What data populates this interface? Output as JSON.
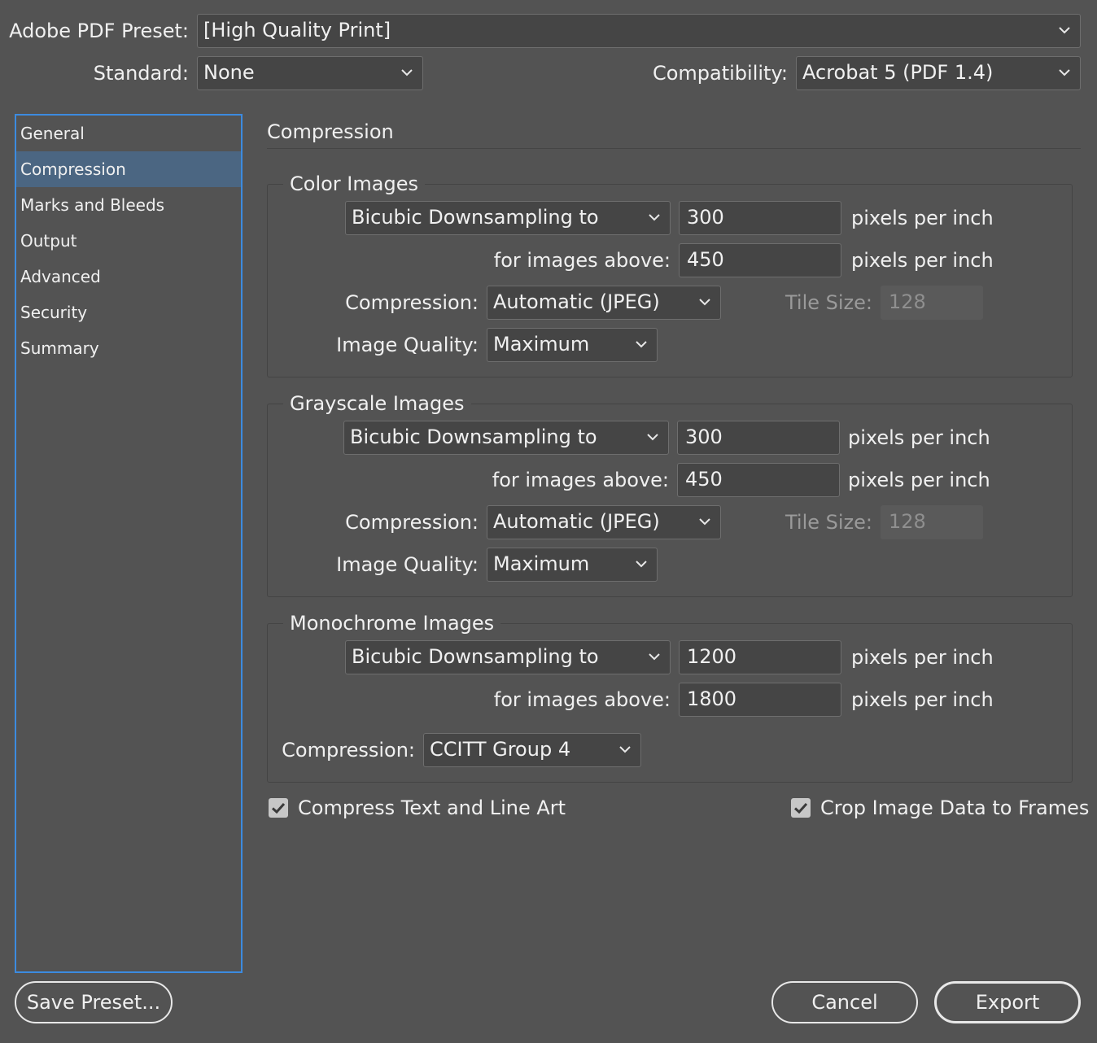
{
  "header": {
    "preset_label": "Adobe PDF Preset:",
    "preset_value": "[High Quality Print]",
    "standard_label": "Standard:",
    "standard_value": "None",
    "compat_label": "Compatibility:",
    "compat_value": "Acrobat 5 (PDF 1.4)"
  },
  "sidebar": {
    "items": [
      {
        "label": "General"
      },
      {
        "label": "Compression"
      },
      {
        "label": "Marks and Bleeds"
      },
      {
        "label": "Output"
      },
      {
        "label": "Advanced"
      },
      {
        "label": "Security"
      },
      {
        "label": "Summary"
      }
    ],
    "selected": "Compression"
  },
  "main": {
    "title": "Compression",
    "color": {
      "title": "Color Images",
      "sampling": "Bicubic Downsampling to",
      "ppi": "300",
      "ppi_unit": "pixels per inch",
      "above_label": "for images above:",
      "above": "450",
      "above_unit": "pixels per inch",
      "compression_label": "Compression:",
      "compression": "Automatic (JPEG)",
      "tile_label": "Tile Size:",
      "tile": "128",
      "quality_label": "Image Quality:",
      "quality": "Maximum"
    },
    "gray": {
      "title": "Grayscale Images",
      "sampling": "Bicubic Downsampling to",
      "ppi": "300",
      "ppi_unit": "pixels per inch",
      "above_label": "for images above:",
      "above": "450",
      "above_unit": "pixels per inch",
      "compression_label": "Compression:",
      "compression": "Automatic (JPEG)",
      "tile_label": "Tile Size:",
      "tile": "128",
      "quality_label": "Image Quality:",
      "quality": "Maximum"
    },
    "mono": {
      "title": "Monochrome Images",
      "sampling": "Bicubic Downsampling to",
      "ppi": "1200",
      "ppi_unit": "pixels per inch",
      "above_label": "for images above:",
      "above": "1800",
      "above_unit": "pixels per inch",
      "compression_label": "Compression:",
      "compression": "CCITT Group 4"
    },
    "compress_text_label": "Compress Text and Line Art",
    "compress_text_checked": true,
    "crop_label": "Crop Image Data to Frames",
    "crop_checked": true
  },
  "footer": {
    "save_preset": "Save Preset...",
    "cancel": "Cancel",
    "export": "Export"
  },
  "colors": {
    "background": "#535353",
    "field": "#454545",
    "selection": "#4b6682",
    "focus_border": "#3c8be0"
  }
}
